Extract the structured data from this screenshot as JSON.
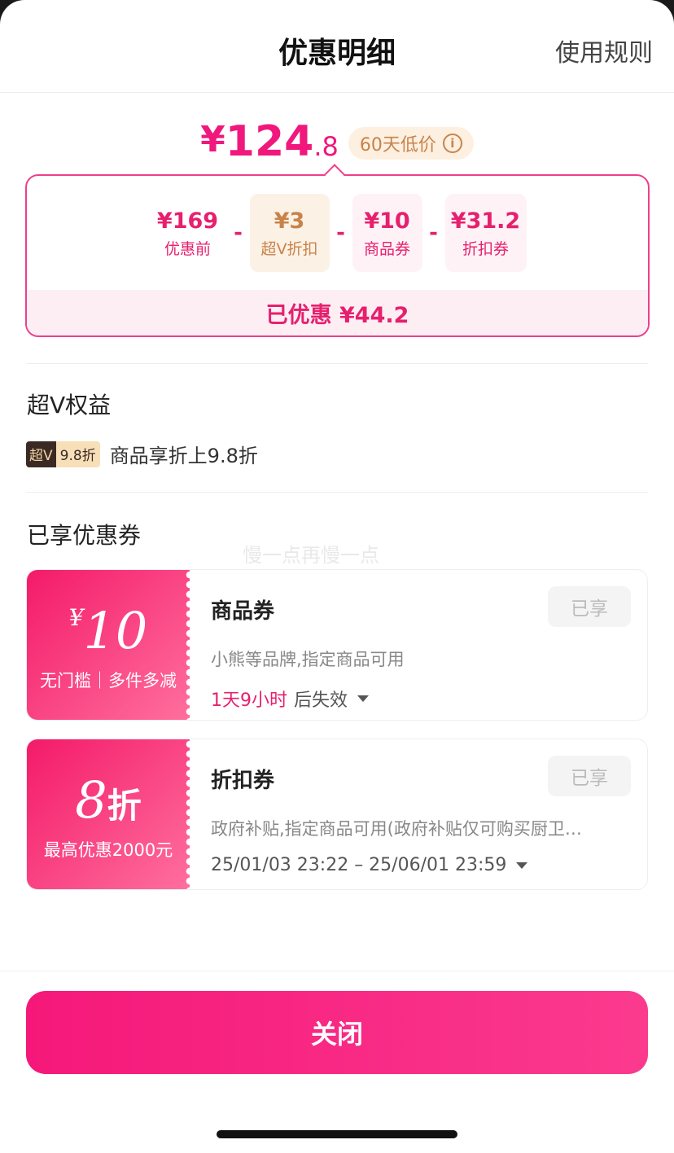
{
  "header": {
    "title": "优惠明细",
    "rules_link": "使用规则"
  },
  "price": {
    "currency": "¥",
    "integer": "124",
    "decimal": ".8",
    "badge": "60天低价",
    "info_icon": "i"
  },
  "breakdown": {
    "items": [
      {
        "value": "¥169",
        "label": "优惠前"
      },
      {
        "value": "¥3",
        "label": "超V折扣"
      },
      {
        "value": "¥10",
        "label": "商品券"
      },
      {
        "value": "¥31.2",
        "label": "折扣券"
      }
    ],
    "operator": "-",
    "saved": "已优惠 ¥44.2"
  },
  "vip": {
    "section_title": "超V权益",
    "badge_left": "超V",
    "badge_right": "9.8折",
    "text": "商品享折上9.8折"
  },
  "coupons_section": {
    "title": "已享优惠券",
    "watermark": "慢一点再慢一点"
  },
  "coupons": [
    {
      "symbol": "¥",
      "amount": "10",
      "unit": "",
      "condition": "无门槛｜多件多减",
      "title": "商品券",
      "status": "已享",
      "desc": "小熊等品牌,指定商品可用",
      "valid_highlight": "1天9小时",
      "valid_text": "后失效"
    },
    {
      "symbol": "",
      "amount": "8",
      "unit": "折",
      "condition": "最高优惠2000元",
      "title": "折扣券",
      "status": "已享",
      "desc": "政府补贴,指定商品可用(政府补贴仅可购买厨卫…",
      "valid_highlight": "",
      "valid_text": "25/01/03 23:22 – 25/06/01 23:59"
    }
  ],
  "footer": {
    "close_label": "关闭"
  },
  "colors": {
    "accent": "#f0187d",
    "gold": "#c8834b"
  }
}
